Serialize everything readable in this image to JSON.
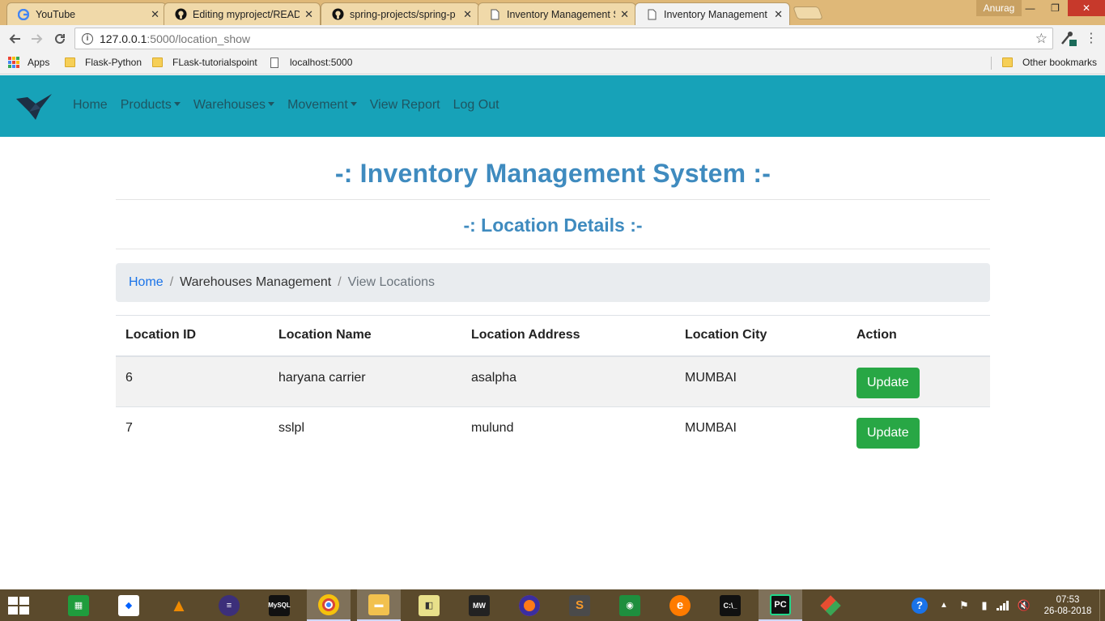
{
  "browser": {
    "tabs": [
      {
        "title": "YouTube",
        "icon": "google-icon",
        "active": false
      },
      {
        "title": "Editing myproject/READM",
        "icon": "github-icon",
        "active": false
      },
      {
        "title": "spring-projects/spring-p",
        "icon": "github-icon",
        "active": false
      },
      {
        "title": "Inventory Management S",
        "icon": "page-icon",
        "active": false
      },
      {
        "title": "Inventory Management S",
        "icon": "page-icon",
        "active": true
      }
    ],
    "profile_name": "Anurag",
    "url_host": "127.0.0.1",
    "url_path": ":5000/location_show",
    "bookmarks": [
      {
        "label": "Apps",
        "icon": "apps-grid-icon"
      },
      {
        "label": "Flask-Python",
        "icon": "folder-icon"
      },
      {
        "label": "FLask-tutorialspoint",
        "icon": "folder-icon"
      },
      {
        "label": "localhost:5000",
        "icon": "page-icon"
      }
    ],
    "other_bookmarks": "Other bookmarks"
  },
  "navbar": {
    "links": [
      {
        "label": "Home",
        "dropdown": false
      },
      {
        "label": "Products",
        "dropdown": true
      },
      {
        "label": "Warehouses",
        "dropdown": true
      },
      {
        "label": "Movement",
        "dropdown": true
      },
      {
        "label": "View Report",
        "dropdown": false
      },
      {
        "label": "Log Out",
        "dropdown": false
      }
    ],
    "background": "#17a2b8"
  },
  "page": {
    "title": "-: Inventory Management System :-",
    "section_title": "-: Location Details :-",
    "breadcrumb": {
      "home": "Home",
      "middle": "Warehouses Management",
      "current": "View Locations"
    },
    "table": {
      "headers": [
        "Location ID",
        "Location Name",
        "Location Address",
        "Location City",
        "Action"
      ],
      "rows": [
        {
          "id": "6",
          "name": "haryana carrier",
          "address": "asalpha",
          "city": "MUMBAI",
          "action": "Update"
        },
        {
          "id": "7",
          "name": "sslpl",
          "address": "mulund",
          "city": "MUMBAI",
          "action": "Update"
        }
      ]
    }
  },
  "taskbar": {
    "apps": [
      "windows-store-icon",
      "dropbox-icon",
      "vlc-icon",
      "eclipse-icon",
      "mysql-icon",
      "chrome-icon",
      "file-explorer-icon",
      "sticky-notes-icon",
      "nfs-mw-icon",
      "firefox-icon",
      "sublime-text-icon",
      "google-classroom-icon",
      "edge-icon",
      "cmd-icon",
      "pycharm-icon",
      "git-icon"
    ],
    "time": "07:53",
    "date": "26-08-2018"
  }
}
